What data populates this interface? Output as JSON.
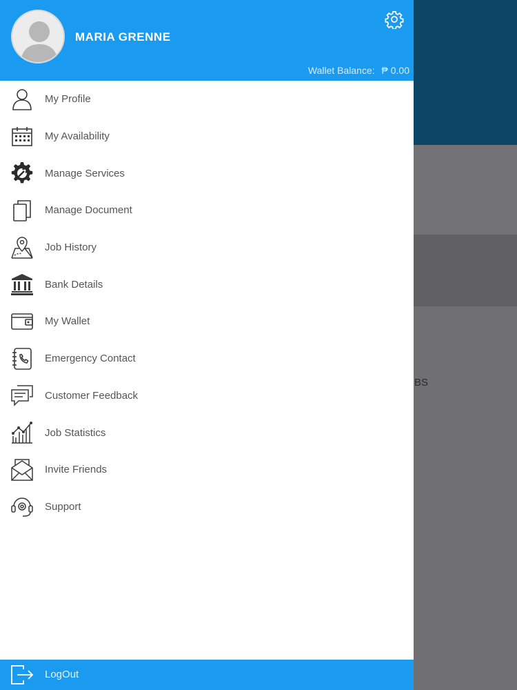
{
  "background": {
    "partial_text": "BS"
  },
  "header": {
    "user_name": "MARIA GRENNE",
    "wallet_label": "Wallet Balance:",
    "wallet_value": "₱ 0.00",
    "settings_icon": "gear-icon"
  },
  "menu": {
    "items": [
      {
        "label": "My Profile",
        "icon": "user-icon"
      },
      {
        "label": "My Availability",
        "icon": "calendar-icon"
      },
      {
        "label": "Manage Services",
        "icon": "wrench-gear-icon"
      },
      {
        "label": "Manage Document",
        "icon": "documents-icon"
      },
      {
        "label": "Job History",
        "icon": "map-pin-icon"
      },
      {
        "label": "Bank Details",
        "icon": "bank-icon"
      },
      {
        "label": "My Wallet",
        "icon": "wallet-icon"
      },
      {
        "label": "Emergency Contact",
        "icon": "phone-book-icon"
      },
      {
        "label": "Customer Feedback",
        "icon": "chat-bubbles-icon"
      },
      {
        "label": "Job Statistics",
        "icon": "chart-icon"
      },
      {
        "label": "Invite Friends",
        "icon": "envelope-icon"
      },
      {
        "label": "Support",
        "icon": "headset-icon"
      }
    ]
  },
  "footer": {
    "label": "LogOut",
    "icon": "logout-icon"
  },
  "colors": {
    "accent": "#1a9bef",
    "icon": "#3a3a3a",
    "text": "#555555"
  }
}
